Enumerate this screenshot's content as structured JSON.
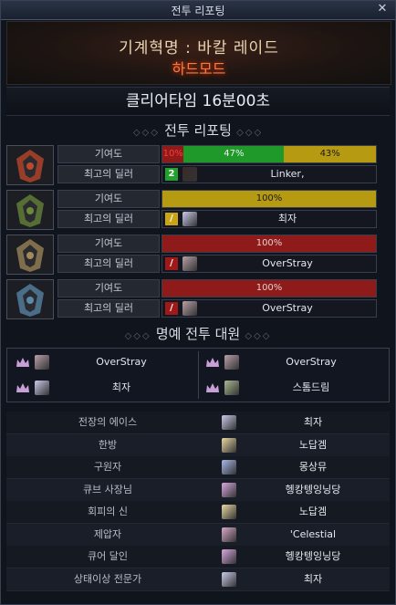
{
  "window": {
    "title": "전투 리포팅"
  },
  "header": {
    "mode": "기계혁명 : 바칼 레이드",
    "difficulty": "하드모드"
  },
  "clear_time": "클리어타임 16분00초",
  "section_report": "전투 리포팅",
  "section_honor": "명예 전투 대원",
  "labels": {
    "contribution": "기여도",
    "top_dealer": "최고의 딜러"
  },
  "bosses": [
    {
      "bar": [
        {
          "text": "10%",
          "value": 10,
          "color": "#8f1a1a",
          "text_color": "#ff3a3a"
        },
        {
          "text": "47%",
          "value": 47,
          "color": "#1f9a2a",
          "text_color": "#f0f0f0"
        },
        {
          "text": "43%",
          "value": 43,
          "color": "#b59a12",
          "text_color": "#1a1a1a"
        }
      ],
      "dealer_badge": "2",
      "badge_color": "#22a030",
      "dealer": "Linker,",
      "avatar_color": "#3a2a2a",
      "frame": "#c0482a"
    },
    {
      "bar": [
        {
          "text": "100%",
          "value": 100,
          "color": "#b59a12",
          "text_color": "#1a1a1a"
        }
      ],
      "dealer_badge": "/",
      "badge_color": "#c9a516",
      "dealer": "최자",
      "avatar_color": "#c9c9e8",
      "frame": "#6a8a3a"
    },
    {
      "bar": [
        {
          "text": "100%",
          "value": 100,
          "color": "#8f1a1a",
          "text_color": "#e0d0d0"
        }
      ],
      "dealer_badge": "/",
      "badge_color": "#a01818",
      "dealer": "OverStray",
      "avatar_color": "#b8a0a8",
      "frame": "#a08a5a"
    },
    {
      "bar": [
        {
          "text": "100%",
          "value": 100,
          "color": "#8f1a1a",
          "text_color": "#e0d0d0"
        }
      ],
      "dealer_badge": "/",
      "badge_color": "#a01818",
      "dealer": "OverStray",
      "avatar_color": "#b8a0a8",
      "frame": "#5a8aaa"
    }
  ],
  "honor": [
    {
      "name": "OverStray",
      "avatar_color": "#b8a0a8"
    },
    {
      "name": "OverStray",
      "avatar_color": "#b8a0a8"
    },
    {
      "name": "최자",
      "avatar_color": "#c9c9e8"
    },
    {
      "name": "스톰드림",
      "avatar_color": "#a8b890"
    }
  ],
  "awards": [
    {
      "title": "전장의 에이스",
      "player": "최자",
      "avatar_color": "#c9c9e8"
    },
    {
      "title": "한방",
      "player": "노답겜",
      "avatar_color": "#e8d8a0"
    },
    {
      "title": "구원자",
      "player": "몽상뮤",
      "avatar_color": "#a8b8e8"
    },
    {
      "title": "큐브 사장님",
      "player": "헹캉텡잉닝당",
      "avatar_color": "#d8a8e0"
    },
    {
      "title": "회피의 신",
      "player": "노답겜",
      "avatar_color": "#e8d8a0"
    },
    {
      "title": "제압자",
      "player": "'Celestial",
      "avatar_color": "#d8a8c8"
    },
    {
      "title": "큐어 달인",
      "player": "헹캉텡잉닝당",
      "avatar_color": "#d8a8e0"
    },
    {
      "title": "상태이상 전문가",
      "player": "최자",
      "avatar_color": "#c9c9e8"
    }
  ]
}
